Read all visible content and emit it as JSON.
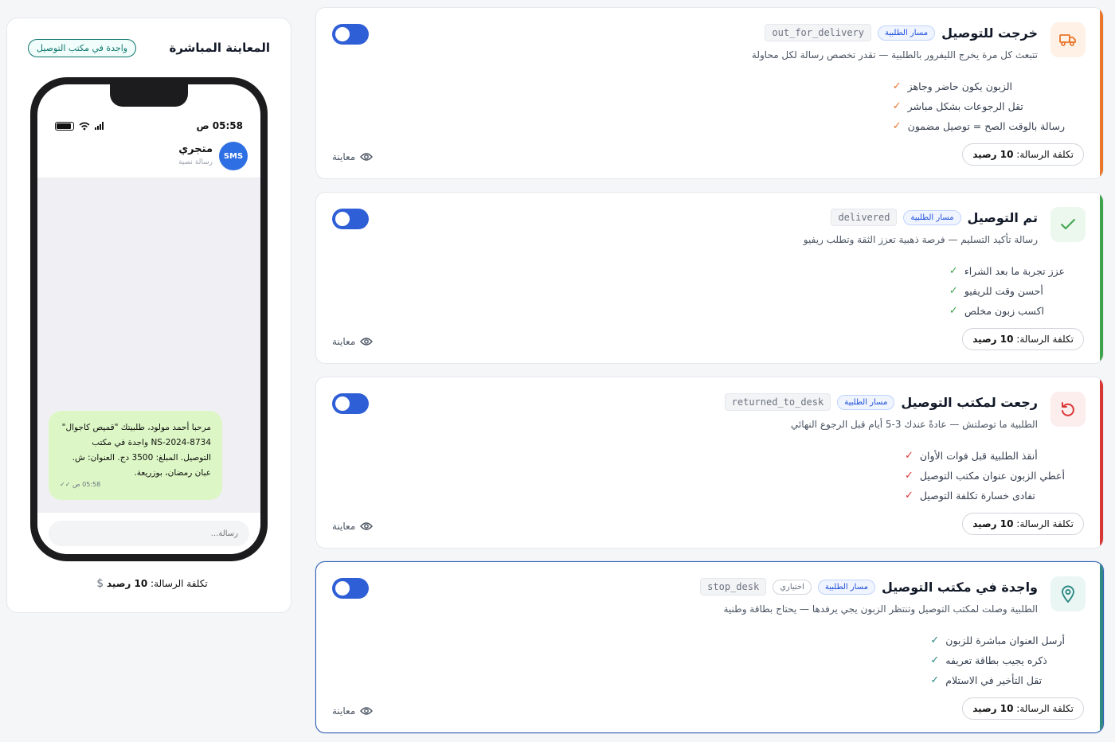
{
  "preview": {
    "title": "المعاينة المباشرة",
    "badge": "واجدة في مكتب التوصيل",
    "phone": {
      "time": "05:58 ص",
      "contact_name": "متجري",
      "contact_sub": "رسالة نصية",
      "avatar_text": "SMS",
      "message": "مرحبا أحمد مولود، طلبيتك \"قميص كاجوال\" NS-2024-8734 واجدة في مكتب التوصيل. المبلغ: 3500 دج. العنوان: ش. عبان رمضان، بوزريعة.",
      "message_meta": "05:58 ص ✓✓",
      "input_placeholder": "رسالة..."
    },
    "cost_label": "تكلفة الرسالة:",
    "cost_value": "10 رصيد"
  },
  "common": {
    "path_badge": "مسار الطلبية",
    "preview_link": "معاينة",
    "cost_label": "تكلفة الرسالة:",
    "cost_value": "10 رصيد"
  },
  "cards": [
    {
      "title": "خرجت للتوصيل",
      "code": "out_for_delivery",
      "optional": "",
      "description": "تتبعث كل مرة يخرج الليفرور بالطلبية — تقدر تخصص رسالة لكل محاولة",
      "benefits": [
        "الزبون يكون حاضر وجاهز",
        "تقل الرجوعات بشكل مباشر",
        "رسالة بالوقت الصح = توصيل مضمون"
      ],
      "icon": "truck-icon",
      "accent": "#e8762b",
      "icon_bg": "#fff1e6",
      "enabled": true,
      "selected": false
    },
    {
      "title": "تم التوصيل",
      "code": "delivered",
      "optional": "",
      "description": "رسالة تأكيد التسليم — فرصة ذهبية تعزز الثقة وتطلب ريفيو",
      "benefits": [
        "عزز تجربة ما بعد الشراء",
        "أحسن وقت للريفيو",
        "اكسب زبون مخلص"
      ],
      "icon": "check-icon",
      "accent": "#3fa34d",
      "icon_bg": "#ecf8ee",
      "enabled": true,
      "selected": false
    },
    {
      "title": "رجعت لمكتب التوصيل",
      "code": "returned_to_desk",
      "optional": "",
      "description": "الطلبية ما توصلتش — عادةً عندك 3-5 أيام قبل الرجوع النهائي",
      "benefits": [
        "أنقذ الطلبية قبل فوات الأوان",
        "أعطي الزبون عنوان مكتب التوصيل",
        "تفادى خسارة تكلفة التوصيل"
      ],
      "icon": "undo-icon",
      "accent": "#d93636",
      "icon_bg": "#fdeeee",
      "enabled": true,
      "selected": false
    },
    {
      "title": "واجدة في مكتب التوصيل",
      "code": "stop_desk",
      "optional": "اختياري",
      "description": "الطلبية وصلت لمكتب التوصيل وتنتظر الزبون يجي يرفدها — يحتاج بطاقة وطنية",
      "benefits": [
        "أرسل العنوان مباشرة للزبون",
        "ذكره يجيب بطاقة تعريفه",
        "تقل التأخير في الاستلام"
      ],
      "icon": "map-pin-icon",
      "accent": "#2e8a83",
      "icon_bg": "#eaf6f4",
      "enabled": true,
      "selected": true
    }
  ]
}
